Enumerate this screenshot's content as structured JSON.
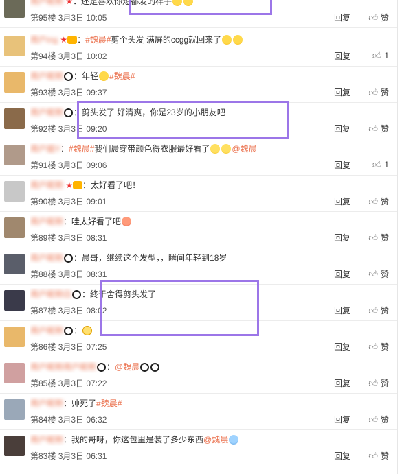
{
  "rows": [
    {
      "name": "用户昵称",
      "badges": [
        "star"
      ],
      "pre_emoji": "",
      "text": "还是喜欢你短都发的样子",
      "tag": "",
      "after": [
        "laugh",
        "laugh"
      ],
      "floor": "第95楼",
      "date": "3月3日",
      "time": "10:05",
      "reply": "回复",
      "like": "赞",
      "avatar_color": "#6b6a58"
    },
    {
      "name": "用户ing",
      "badges": [
        "star",
        "vip"
      ],
      "pre_emoji": "",
      "text": "剪个头发 满屏的ccgg就回来了",
      "tag": "#魏晨#",
      "after": [
        "laugh",
        "laugh"
      ],
      "floor": "第94楼",
      "date": "3月3日",
      "time": "10:02",
      "reply": "回复",
      "like": "1",
      "avatar_color": "#e8c27a"
    },
    {
      "name": "用户昵称",
      "badges": [],
      "pre_emoji": "panda",
      "text": "年轻",
      "tag": "",
      "after": [
        "laugh"
      ],
      "tail_tag": "#魏晨#",
      "floor": "第93楼",
      "date": "3月3日",
      "time": "09:37",
      "reply": "回复",
      "like": "赞",
      "avatar_color": "#e9b86a"
    },
    {
      "name": "用户昵称",
      "badges": [],
      "pre_emoji": "panda",
      "text": "剪头发了  好清爽，你是23岁的小朋友吧",
      "tag": "",
      "after": [],
      "floor": "第92楼",
      "date": "3月3日",
      "time": "09:20",
      "reply": "回复",
      "like": "赞",
      "avatar_color": "#8a6a4a"
    },
    {
      "name": "用户姐Y",
      "badges": [],
      "pre_emoji": "",
      "text": "我们晨穿带颜色得衣服最好看了",
      "tag": "#魏晨#",
      "after": [
        "shock",
        "shock"
      ],
      "tail_tag": "@魏晨",
      "floor": "第91楼",
      "date": "3月3日",
      "time": "09:06",
      "reply": "回复",
      "like": "1",
      "avatar_color": "#b09a8a"
    },
    {
      "name": "用户昵称",
      "badges": [
        "star",
        "vip"
      ],
      "pre_emoji": "",
      "text": "太好看了吧！",
      "tag": "",
      "after": [],
      "floor": "第90楼",
      "date": "3月3日",
      "time": "09:01",
      "reply": "回复",
      "like": "赞",
      "avatar_color": "#c8c8c8"
    },
    {
      "name": "用户昵称",
      "badges": [],
      "pre_emoji": "",
      "text": "哇太好看了吧",
      "tag": "",
      "after": [
        "lick"
      ],
      "floor": "第89楼",
      "date": "3月3日",
      "time": "08:31",
      "reply": "回复",
      "like": "赞",
      "avatar_color": "#a0886e"
    },
    {
      "name": "用户昵称",
      "badges": [],
      "pre_emoji": "panda",
      "text": "晨哥，继续这个发型，，瞬间年轻到18岁",
      "tag": "",
      "after": [],
      "floor": "第88楼",
      "date": "3月3日",
      "time": "08:31",
      "reply": "回复",
      "like": "赞",
      "avatar_color": "#5a5e6a"
    },
    {
      "name": "用户昵称白",
      "badges": [],
      "pre_emoji": "panda",
      "text": "终于舍得剪头发了",
      "tag": "",
      "after": [],
      "floor": "第87楼",
      "date": "3月3日",
      "time": "08:02",
      "reply": "回复",
      "like": "赞",
      "avatar_color": "#3a3a4a"
    },
    {
      "name": "用户昵称",
      "badges": [],
      "pre_emoji": "panda",
      "text": "",
      "tag": "",
      "after": [
        "smile"
      ],
      "floor": "第86楼",
      "date": "3月3日",
      "time": "07:25",
      "reply": "回复",
      "like": "赞",
      "avatar_color": "#e9b86a"
    },
    {
      "name": "用户昵称用户昵称",
      "badges": [],
      "pre_emoji": "panda",
      "text": "",
      "tag": "",
      "after": [],
      "tail_tag": "@魏晨",
      "tail_emoji": [
        "panda",
        "panda"
      ],
      "floor": "第85楼",
      "date": "3月3日",
      "time": "07:22",
      "reply": "回复",
      "like": "赞",
      "avatar_color": "#d0a0a0"
    },
    {
      "name": "用户昵称",
      "badges": [],
      "pre_emoji": "",
      "text": "帅死了",
      "tag": "",
      "after": [],
      "tail_tag": "#魏晨#",
      "floor": "第84楼",
      "date": "3月3日",
      "time": "06:32",
      "reply": "回复",
      "like": "赞",
      "avatar_color": "#9aa8b8"
    },
    {
      "name": "用户昵称",
      "badges": [],
      "pre_emoji": "",
      "text": "我的哥呀，你这包里是装了多少东西",
      "tag": "",
      "after": [],
      "tail_tag": "@魏晨",
      "tail_emoji": [
        "cry"
      ],
      "floor": "第83楼",
      "date": "3月3日",
      "time": "06:31",
      "reply": "回复",
      "like": "赞",
      "avatar_color": "#4a3e3a"
    }
  ],
  "colors": {
    "accent": "#eb7350",
    "highlight": "#9c76e8"
  }
}
